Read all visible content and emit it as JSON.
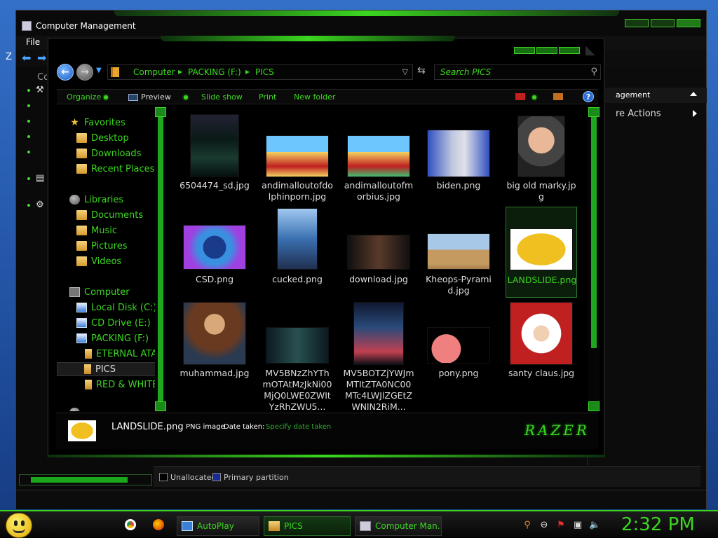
{
  "computer_management": {
    "title": "Computer Management",
    "menu_file": "File",
    "co_truncated": "Co",
    "actions_header": "agement",
    "more_actions": "re Actions",
    "legend_unallocated": "Unallocated",
    "legend_primary": "Primary partition"
  },
  "explorer": {
    "breadcrumb": [
      "Computer",
      "PACKING (F:)",
      "PICS"
    ],
    "search_placeholder": "Search PICS",
    "commands": {
      "organize": "Organize",
      "preview": "Preview",
      "slideshow": "Slide show",
      "print": "Print",
      "new_folder": "New folder"
    },
    "nav": {
      "favorites": "Favorites",
      "desktop": "Desktop",
      "downloads": "Downloads",
      "recent_places": "Recent Places",
      "libraries": "Libraries",
      "documents": "Documents",
      "music": "Music",
      "pictures": "Pictures",
      "videos": "Videos",
      "computer": "Computer",
      "local_disk": "Local Disk (C:)",
      "cd_drive": "CD Drive (E:)",
      "packing": "PACKING (F:)",
      "eternal": "ETERNAL ATA",
      "pics": "PICS",
      "red_white": "RED & WHITE"
    },
    "files": [
      {
        "name": "6504474_sd.jpg"
      },
      {
        "name": "andimalloutofdolphinporn.jpg"
      },
      {
        "name": "andimalloutofmorbius.jpg"
      },
      {
        "name": "biden.png"
      },
      {
        "name": "big old marky.jpg"
      },
      {
        "name": "CSD.png"
      },
      {
        "name": "cucked.png"
      },
      {
        "name": "download.jpg"
      },
      {
        "name": "Kheops-Pyramid.jpg"
      },
      {
        "name": "LANDSLIDE.png"
      },
      {
        "name": "muhammad.jpg"
      },
      {
        "name": "MV5BNzZhYThmOTAtMzJkNi00MjQ0LWE0ZWItYzRhZWU5..."
      },
      {
        "name": "MV5BOTZjYWJmMTItZTA0NC00MTc4LWJlZGEtZWNlN2RiM..."
      },
      {
        "name": "pony.png"
      },
      {
        "name": "santy claus.jpg"
      }
    ],
    "details": {
      "name": "LANDSLIDE.png",
      "type": "PNG image",
      "date_label": "Date taken:",
      "date_value": "Specify date taken",
      "brand": "RAZER"
    }
  },
  "taskbar": {
    "autoplay": "AutoPlay",
    "pics": "PICS",
    "computer_management": "Computer Man...",
    "clock": "2:32 PM"
  },
  "colors": {
    "accent": "#3bd620",
    "background": "#000000"
  }
}
